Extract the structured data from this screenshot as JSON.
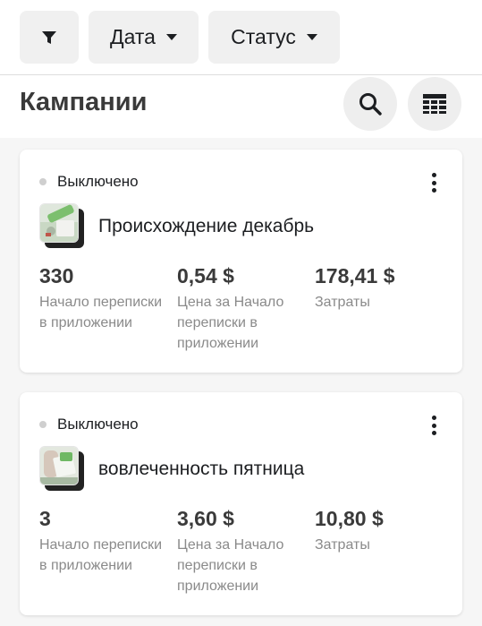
{
  "filters": {
    "date_label": "Дата",
    "status_label": "Статус"
  },
  "header": {
    "title": "Кампании"
  },
  "colors": {
    "status_off": "#cfcfcf",
    "text_primary": "#1c1e21",
    "text_secondary": "#8a8a8a"
  },
  "campaigns": [
    {
      "status": "Выключено",
      "name": "Происхождение декабрь",
      "metrics": [
        {
          "value": "330",
          "label": "Начало переписки в приложении"
        },
        {
          "value": "0,54 $",
          "label": "Цена за Начало переписки в приложении"
        },
        {
          "value": "178,41 $",
          "label": "Затраты"
        }
      ]
    },
    {
      "status": "Выключено",
      "name": "вовлеченность пятница",
      "metrics": [
        {
          "value": "3",
          "label": "Начало переписки в приложении"
        },
        {
          "value": "3,60 $",
          "label": "Цена за Начало переписки в приложении"
        },
        {
          "value": "10,80 $",
          "label": "Затраты"
        }
      ]
    }
  ]
}
